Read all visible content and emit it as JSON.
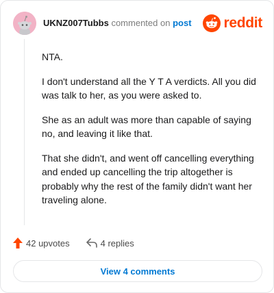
{
  "header": {
    "username": "UKNZ007Tubbs",
    "commented_on": "commented on",
    "post_link": "post",
    "logo_text": "reddit",
    "brand_color": "#ff4500",
    "link_color": "#0079d3"
  },
  "comment": {
    "paragraphs": [
      "NTA.",
      "I don't understand all the Y T A verdicts. All you did was talk to her, as you were asked to.",
      "She as an adult was more than capable of saying no, and leaving it like that.",
      "That she didn't, and went off cancelling everything and ended up cancelling the trip altogether is probably why the rest of the family didn't want her traveling alone."
    ]
  },
  "actions": {
    "upvotes": "42 upvotes",
    "replies": "4 replies",
    "upvote_icon": "upvote-arrow-icon",
    "reply_icon": "reply-arrow-icon"
  },
  "footer": {
    "view_comments": "View 4 comments"
  }
}
